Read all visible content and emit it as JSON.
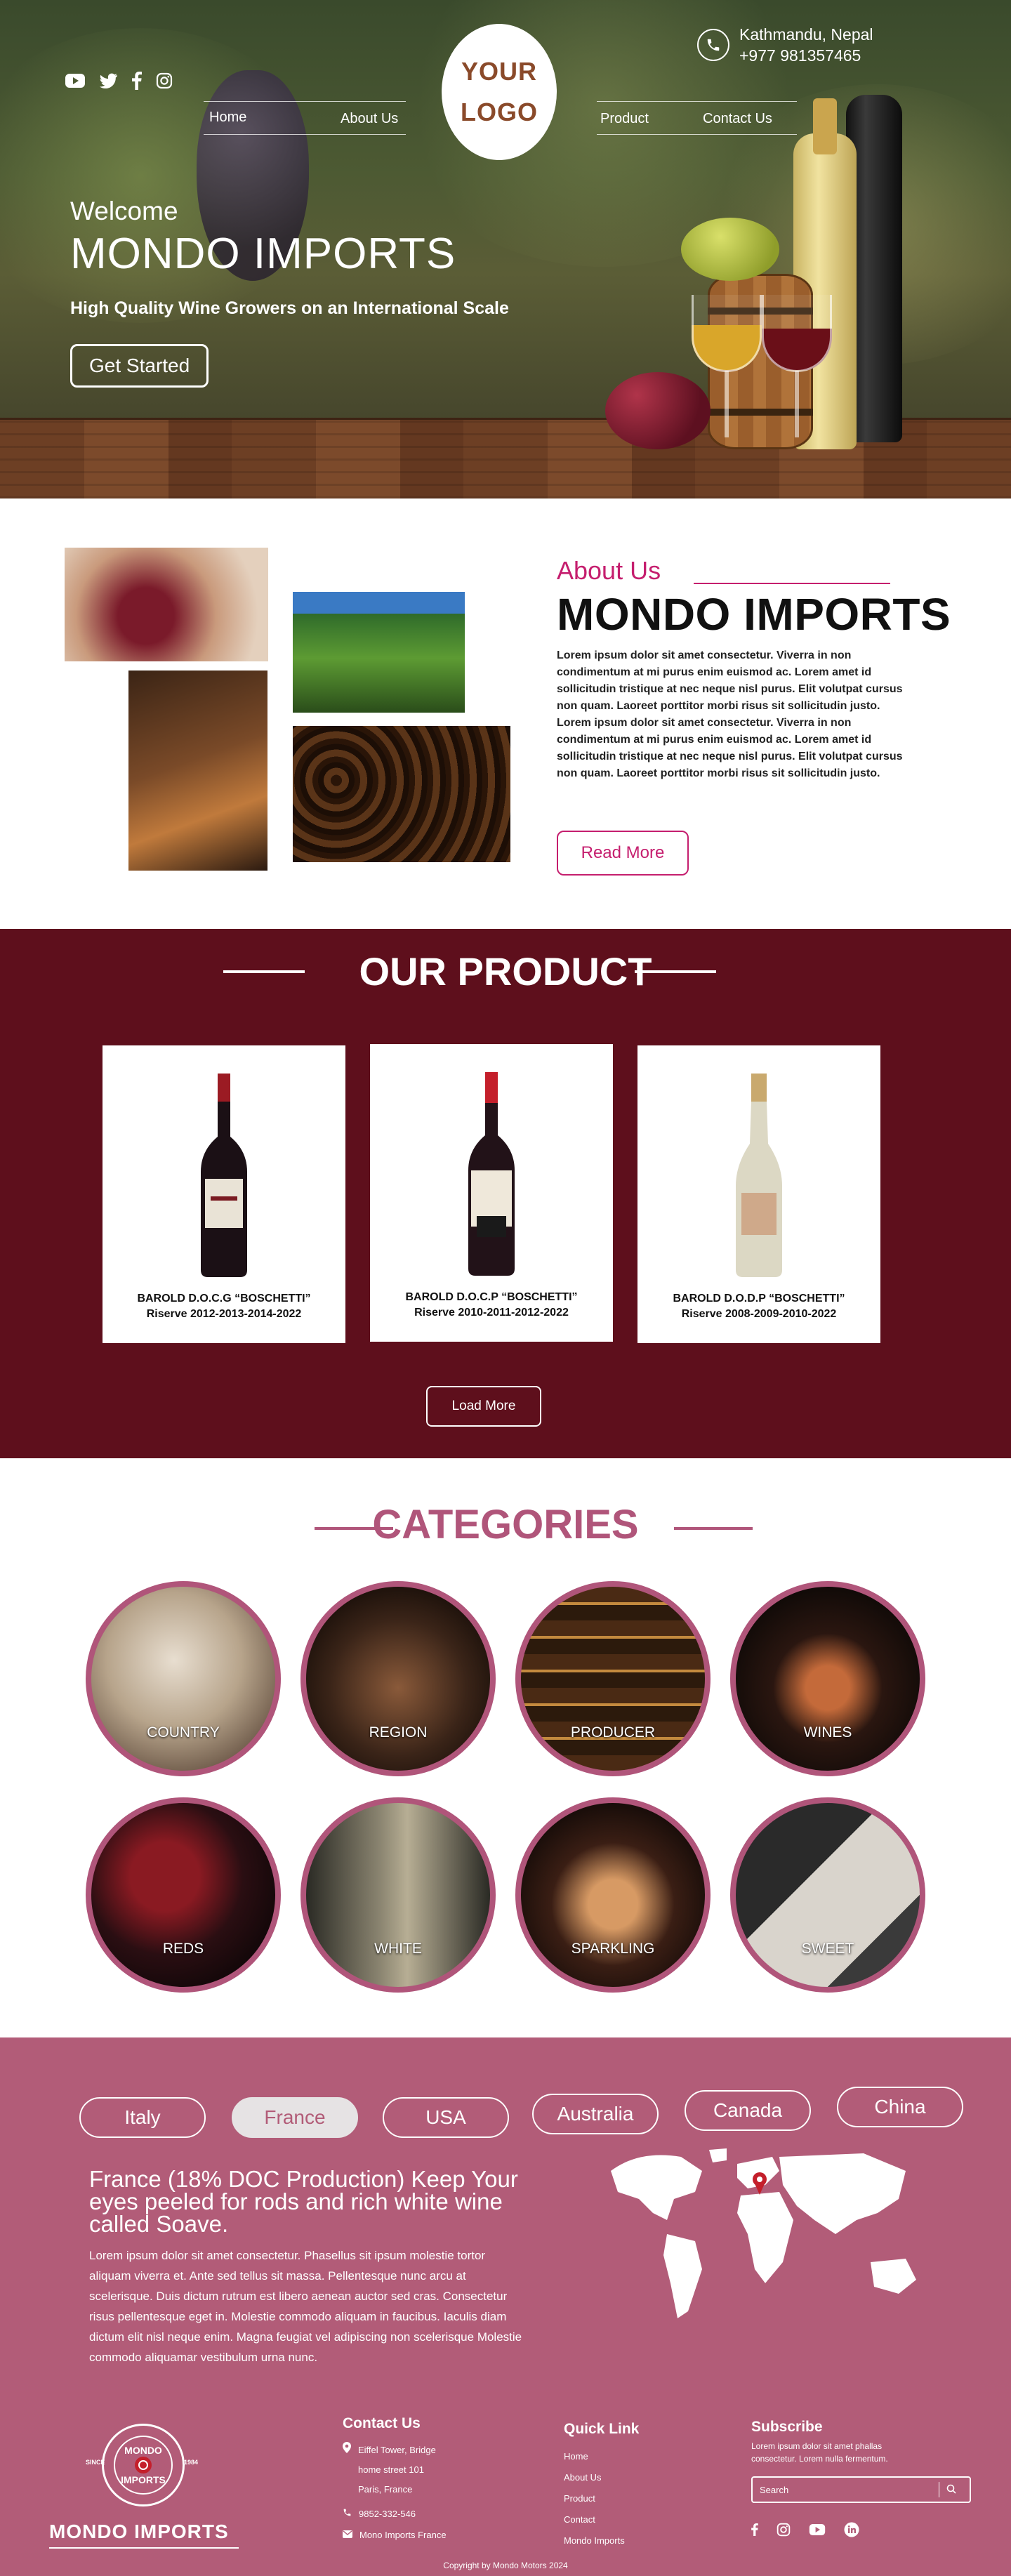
{
  "hero": {
    "location": "Kathmandu, Nepal",
    "phone": "+977  981357465",
    "logo_line1": "YOUR",
    "logo_line2": "LOGO",
    "nav": [
      "Home",
      "About Us",
      "Product",
      "Contact Us"
    ],
    "welcome": "Welcome",
    "title": "MONDO IMPORTS",
    "tagline": "High Quality Wine Growers on an International Scale",
    "cta": "Get Started",
    "social_icons": [
      "youtube-icon",
      "twitter-icon",
      "facebook-icon",
      "instagram-icon"
    ]
  },
  "about": {
    "tag": "About Us",
    "title": "MONDO IMPORTS",
    "paragraph1": "Lorem ipsum dolor sit amet consectetur. Viverra in non condimentum at mi purus enim euismod ac. Lorem amet id sollicitudin tristique at nec neque nisl purus. Elit volutpat cursus non quam. Laoreet porttitor morbi risus sit sollicitudin justo.",
    "paragraph2": "Lorem ipsum dolor sit amet consectetur. Viverra in non condimentum at mi purus enim euismod ac. Lorem amet id sollicitudin tristique at nec neque nisl purus. Elit volutpat cursus non quam. Laoreet porttitor morbi risus sit sollicitudin justo.",
    "button": "Read More"
  },
  "products": {
    "title": "OUR PRODUCT",
    "items": [
      {
        "line1": "BAROLD D.O.C.G “BOSCHETTI”",
        "line2": "Riserve 2012-2013-2014-2022"
      },
      {
        "line1": "BAROLD D.O.C.P “BOSCHETTI”",
        "line2": "Riserve 2010-2011-2012-2022"
      },
      {
        "line1": "BAROLD D.O.D.P “BOSCHETTI”",
        "line2": "Riserve 2008-2009-2010-2022"
      }
    ],
    "button": "Load More"
  },
  "categories": {
    "title": "CATEGORIES",
    "items": [
      "COUNTRY",
      "REGION",
      "PRODUCER",
      "WINES",
      "REDS",
      "WHITE",
      "SPARKLING",
      "SWEET"
    ]
  },
  "regions": {
    "tabs": [
      "Italy",
      "France",
      "USA",
      "Australia",
      "Canada",
      "China"
    ],
    "active": "France",
    "heading": "France (18% DOC Production) Keep Your eyes peeled for rods and rich white wine called Soave.",
    "body": "Lorem ipsum dolor sit amet consectetur. Phasellus sit ipsum molestie tortor aliquam viverra et. Ante sed tellus sit massa. Pellentesque nunc arcu at scelerisque. Duis dictum rutrum est libero aenean auctor sed cras. Consectetur risus pellentesque eget in. Molestie commodo aliquam in faucibus. Iaculis diam dictum elit nisl neque enim. Magna feugiat vel adipiscing non scelerisque Molestie commodo aliquamar vestibulum urna nunc."
  },
  "footer": {
    "brand": "MONDO IMPORTS",
    "seal_top": "MONDO",
    "seal_bottom": "IMPORTS",
    "seal_left": "SINCE",
    "seal_right": "1984",
    "contact_title": "Contact Us",
    "address1": "Eiffel Tower, Bridge",
    "address2": "home street 101",
    "address3": "Paris, France",
    "phone": "9852-332-546",
    "email": "Mono Imports France",
    "quick_title": "Quick Link",
    "links": [
      "Home",
      "About Us",
      "Product",
      "Contact",
      "Mondo Imports"
    ],
    "subscribe_title": "Subscribe",
    "subscribe_text": "Lorem ipsum dolor sit amet phallas consectetur. Lorem nulla fermentum.",
    "search_placeholder": "Search",
    "copyright": "Copyright by Mondo Motors 2024"
  },
  "colors": {
    "maroon": "#5e0f1c",
    "rose": "#b25c78",
    "accent": "#c51e6e"
  }
}
